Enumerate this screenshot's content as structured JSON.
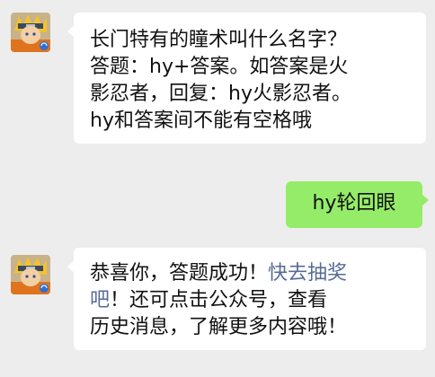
{
  "chat": {
    "bot_name_icon": "naruto-avatar",
    "messages": [
      {
        "side": "left",
        "lines": [
          "长门特有的瞳术叫什么名字？",
          "答题：hy+答案。如答案是火",
          "影忍者，回复：hy火影忍者。",
          "hy和答案间不能有空格哦"
        ]
      },
      {
        "side": "right",
        "text": "hy轮回眼"
      },
      {
        "side": "left",
        "line1_text": "恭喜你，答题成功！",
        "line1_link": "快去抽奖",
        "line2_link": "吧",
        "line2_text": "！还可点击公众号，查看",
        "line3_text": "历史消息，了解更多内容哦！"
      }
    ]
  },
  "colors": {
    "background": "#ededed",
    "left_bubble": "#ffffff",
    "right_bubble": "#95ec69",
    "link": "#576b95"
  }
}
